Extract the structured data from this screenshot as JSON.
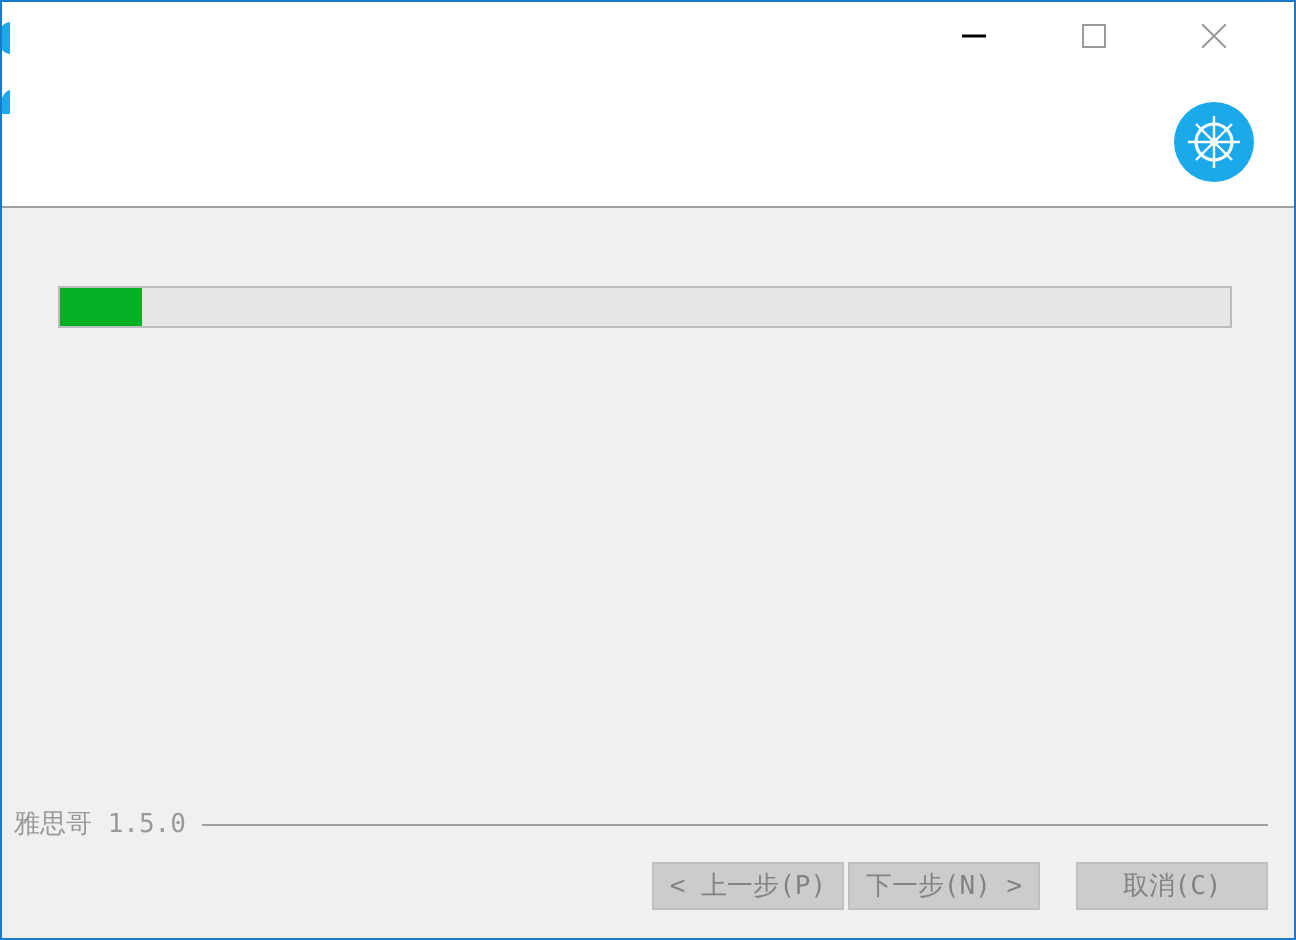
{
  "window": {
    "controls": [
      {
        "kind": "minimize"
      },
      {
        "kind": "maximize"
      },
      {
        "kind": "close"
      }
    ]
  },
  "progress": {
    "level": 0.07
  },
  "footer": {
    "brand": "雅思哥 1.5.0"
  },
  "buttons": [
    {
      "label": "< 上一步(P)",
      "disabled": true
    },
    {
      "label": "下一步(N) >",
      "disabled": true
    },
    {
      "label": "取消(C)",
      "disabled": true
    }
  ]
}
